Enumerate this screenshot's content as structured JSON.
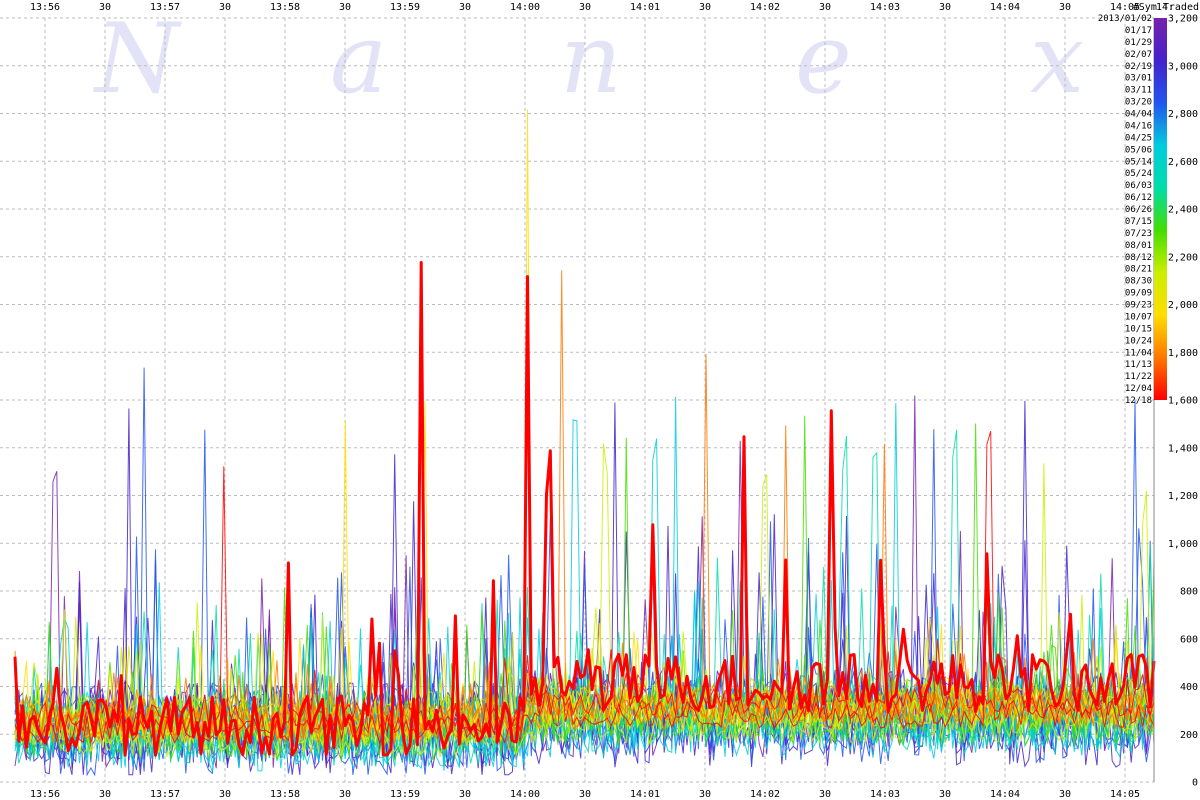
{
  "chart_data": {
    "type": "line",
    "watermark_letters": [
      "N",
      "a",
      "n",
      "e",
      "x"
    ],
    "y_axis_label": "#Sym Traded",
    "time_label_cut": "14:",
    "ylim": [
      0,
      3200
    ],
    "y_ticks": [
      "0",
      "200",
      "400",
      "600",
      "800",
      "1,000",
      "1,200",
      "1,400",
      "1,600",
      "1,800",
      "2,000",
      "2,200",
      "2,400",
      "2,600",
      "2,800",
      "3,000",
      "3,200"
    ],
    "x_tick_labels": [
      "13:56",
      "30",
      "13:57",
      "30",
      "13:58",
      "30",
      "13:59",
      "30",
      "14:00",
      "30",
      "14:01",
      "30",
      "14:02",
      "30",
      "14:03",
      "30",
      "14:04",
      "30",
      "14:05"
    ],
    "x_range": [
      "13:55:45",
      "14:05:30"
    ],
    "grid": true,
    "legend_placement": "right",
    "legend_year_label": "2013/01/02",
    "legend_dates": [
      "01/17",
      "01/29",
      "02/07",
      "02/19",
      "03/01",
      "03/11",
      "03/20",
      "04/04",
      "04/16",
      "04/25",
      "05/06",
      "05/14",
      "05/24",
      "06/03",
      "06/12",
      "06/26",
      "07/15",
      "07/23",
      "08/01",
      "08/12",
      "08/21",
      "08/30",
      "09/09",
      "09/23",
      "10/07",
      "10/15",
      "10/24",
      "11/04",
      "11/13",
      "11/22",
      "12/04",
      "12/18"
    ],
    "legend_scale_labels": [
      "3,200",
      "3,000",
      "2,800",
      "2,600",
      "2,400",
      "2,200",
      "2,000",
      "1,800",
      "1,600"
    ],
    "colors": {
      "highlight": "#ff0000",
      "grid": "#bbbbbb",
      "watermark": "#e3e3f7",
      "spectrum": [
        "#ff0000",
        "#ff7700",
        "#ffdd00",
        "#ccee00",
        "#44dd00",
        "#00ddaa",
        "#00ccdd",
        "#2255ee",
        "#4422cc",
        "#7722aa"
      ]
    },
    "highlight_series": {
      "date": "12/18",
      "spikes": [
        {
          "time": "13:59:08",
          "value": 2230
        },
        {
          "time": "14:00:01",
          "value": 2240
        },
        {
          "time": "14:00:12",
          "value": 1600
        },
        {
          "time": "14:01:49",
          "value": 1600
        },
        {
          "time": "14:02:33",
          "value": 1600
        }
      ]
    },
    "series": [
      {
        "date": "2013/01/02",
        "spikes": [
          {
            "time": "13:56:05",
            "value": 1580
          },
          {
            "time": "14:01:48",
            "value": 1560
          }
        ]
      },
      {
        "date": "01/17",
        "spikes": [
          {
            "time": "14:03:15",
            "value": 1650
          }
        ]
      },
      {
        "date": "01/29",
        "spikes": [
          {
            "time": "14:01:50",
            "value": 1420
          }
        ]
      },
      {
        "date": "02/07",
        "spikes": [
          {
            "time": "14:04:10",
            "value": 1610
          },
          {
            "time": "13:58:55",
            "value": 1420
          }
        ]
      },
      {
        "date": "02/19",
        "spikes": [
          {
            "time": "14:00:45",
            "value": 1610
          }
        ]
      },
      {
        "date": "03/01",
        "spikes": [
          {
            "time": "13:56:42",
            "value": 1580
          }
        ]
      },
      {
        "date": "03/11",
        "spikes": [
          {
            "time": "14:03:25",
            "value": 1680
          }
        ]
      },
      {
        "date": "03/20",
        "spikes": [
          {
            "time": "14:05:05",
            "value": 1600
          }
        ]
      },
      {
        "date": "04/04",
        "spikes": [
          {
            "time": "13:56:50",
            "value": 1910
          },
          {
            "time": "13:57:20",
            "value": 1500
          }
        ]
      },
      {
        "date": "04/16",
        "spikes": [
          {
            "time": "14:01:05",
            "value": 1720
          }
        ]
      },
      {
        "date": "04/25",
        "spikes": [
          {
            "time": "14:03:05",
            "value": 1730
          }
        ]
      },
      {
        "date": "05/06",
        "spikes": [
          {
            "time": "14:00:25",
            "value": 1870
          }
        ]
      },
      {
        "date": "05/14",
        "spikes": [
          {
            "time": "14:01:15",
            "value": 1720
          }
        ]
      },
      {
        "date": "05/24",
        "spikes": [
          {
            "time": "14:02:40",
            "value": 1700
          }
        ]
      },
      {
        "date": "06/03",
        "spikes": [
          {
            "time": "14:02:55",
            "value": 1690
          }
        ]
      },
      {
        "date": "06/12",
        "spikes": [
          {
            "time": "14:03:35",
            "value": 1750
          }
        ]
      },
      {
        "date": "06/26",
        "spikes": [
          {
            "time": "14:00:50",
            "value": 1650
          }
        ]
      },
      {
        "date": "07/15",
        "spikes": [
          {
            "time": "14:02:20",
            "value": 1580
          }
        ]
      },
      {
        "date": "07/23",
        "spikes": [
          {
            "time": "14:03:45",
            "value": 1590
          }
        ]
      },
      {
        "date": "08/01",
        "spikes": [
          {
            "time": "14:00:40",
            "value": 1670
          }
        ]
      },
      {
        "date": "08/12",
        "spikes": [
          {
            "time": "14:02:00",
            "value": 1560
          }
        ]
      },
      {
        "date": "08/21",
        "spikes": [
          {
            "time": "14:04:20",
            "value": 1500
          }
        ]
      },
      {
        "date": "08/30",
        "spikes": [
          {
            "time": "14:05:10",
            "value": 1420
          }
        ]
      },
      {
        "date": "09/09",
        "spikes": [
          {
            "time": "14:00:01",
            "value": 2980
          }
        ]
      },
      {
        "date": "09/23",
        "spikes": [
          {
            "time": "13:58:30",
            "value": 1560
          }
        ]
      },
      {
        "date": "10/07",
        "spikes": [
          {
            "time": "13:59:10",
            "value": 1600
          }
        ]
      },
      {
        "date": "10/15",
        "spikes": [
          {
            "time": "14:02:10",
            "value": 1610
          }
        ]
      },
      {
        "date": "10/24",
        "spikes": [
          {
            "time": "14:01:30",
            "value": 1990
          }
        ]
      },
      {
        "date": "11/04",
        "spikes": [
          {
            "time": "14:00:18",
            "value": 2310
          }
        ]
      },
      {
        "date": "11/13",
        "spikes": [
          {
            "time": "14:03:00",
            "value": 1500
          }
        ]
      },
      {
        "date": "11/22",
        "spikes": [
          {
            "time": "13:57:30",
            "value": 1500
          }
        ]
      },
      {
        "date": "12/04",
        "spikes": [
          {
            "time": "14:03:52",
            "value": 1780
          }
        ]
      }
    ]
  }
}
